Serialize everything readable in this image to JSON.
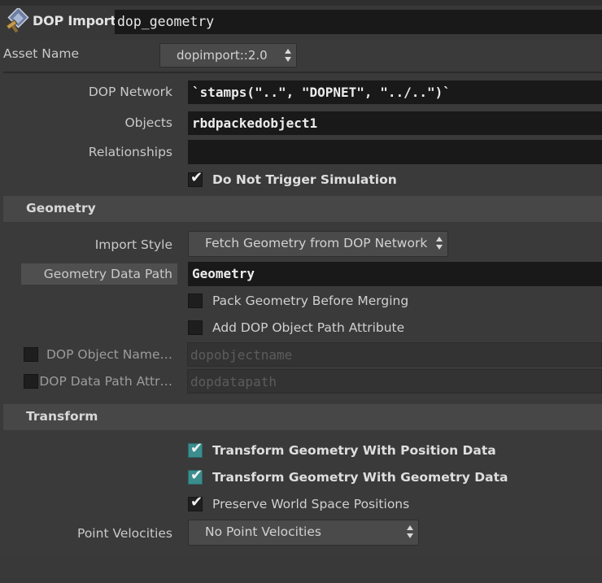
{
  "header": {
    "node_type": "DOP Import",
    "node_name": "dop_geometry"
  },
  "asset": {
    "label": "Asset Name",
    "value": "dopimport::2.0"
  },
  "params": {
    "dop_network_label": "DOP Network",
    "dop_network_value": "`stamps(\"..\", \"DOPNET\", \"../..\")`",
    "objects_label": "Objects",
    "objects_value": "rbdpackedobject1",
    "relationships_label": "Relationships",
    "relationships_value": "",
    "do_not_trigger_label": "Do Not Trigger Simulation"
  },
  "geometry_section": {
    "title": "Geometry",
    "import_style_label": "Import Style",
    "import_style_value": "Fetch Geometry from DOP Network",
    "geo_data_path_label": "Geometry Data Path",
    "geo_data_path_value": "Geometry",
    "pack_label": "Pack Geometry Before Merging",
    "add_path_attr_label": "Add DOP Object Path Attribute",
    "dop_object_name_label": "DOP Object Name…",
    "dop_object_name_value": "dopobjectname",
    "dop_data_path_attr_label": "DOP Data Path Attr…",
    "dop_data_path_attr_value": "dopdatapath"
  },
  "transform_section": {
    "title": "Transform",
    "position_label": "Transform Geometry With Position Data",
    "geometry_label": "Transform Geometry With Geometry Data",
    "preserve_label": "Preserve World Space Positions",
    "point_velocities_label": "Point Velocities",
    "point_velocities_value": "No Point Velocities"
  },
  "checks": {
    "do_not_trigger": true,
    "pack": false,
    "add_path_attr": false,
    "dop_object_name_toggle": false,
    "dop_data_path_toggle": false,
    "transform_position": true,
    "transform_geometry": true,
    "preserve_world": true
  },
  "colors": {
    "background": "#3a3a3a",
    "field": "#191919",
    "section": "#474747",
    "accent_checked": "#3b8d8e"
  }
}
